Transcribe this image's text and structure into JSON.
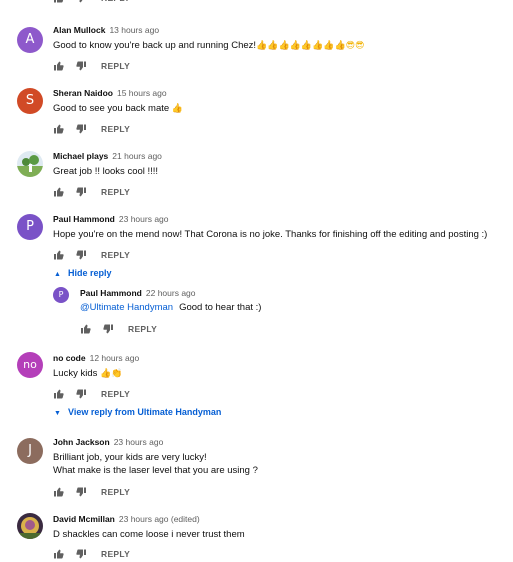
{
  "labels": {
    "reply": "REPLY",
    "hide_reply": "Hide reply",
    "view_reply": "View reply from Ultimate Handyman"
  },
  "colors": {
    "link": "#065fd4",
    "muted": "#606060"
  },
  "comments": [
    {
      "author": "Alan Mullock",
      "time": "13 hours ago",
      "initial": "A",
      "avatar_color": "#8e59cb",
      "text": "Good to know you're back up and running Chez!",
      "emoji": "👍👍👍👍👍👍👍👍😎😎"
    },
    {
      "author": "Sheran Naidoo",
      "time": "15 hours ago",
      "initial": "S",
      "avatar_color": "#d14a26",
      "text": "Good to see you back mate",
      "emoji": "👍"
    },
    {
      "author": "Michael plays",
      "time": "21 hours ago",
      "avatar_icon": "landscape-avatar-image",
      "text": "Great job !!  looks cool !!!!"
    },
    {
      "author": "Paul Hammond",
      "time": "23 hours ago",
      "initial": "P",
      "avatar_color": "#7a52c7",
      "text": "Hope you're on the mend now! That Corona is no joke. Thanks for finishing off the editing and posting :)"
    },
    {
      "author": "no code",
      "time": "12 hours ago",
      "initial": "no",
      "avatar_color": "#b43fb9",
      "text": "Lucky  kids ",
      "emoji": "👍👏"
    },
    {
      "author": "John Jackson",
      "time": "23 hours ago",
      "initial": "J",
      "avatar_color": "#8c6c5e",
      "text": "Brilliant job, your kids are very lucky!",
      "text2": "What make is the laser level that you are using ?"
    },
    {
      "author": "David Mcmillan",
      "time": "23 hours ago (edited)",
      "avatar_icon": "photo-avatar-image",
      "text": "D shackles can come loose i never trust them"
    }
  ],
  "reply": {
    "author": "Paul Hammond",
    "time": "22 hours ago",
    "initial": "P",
    "avatar_color": "#7a52c7",
    "mention": "@Ultimate Handyman",
    "text": "Good to hear that :)"
  }
}
